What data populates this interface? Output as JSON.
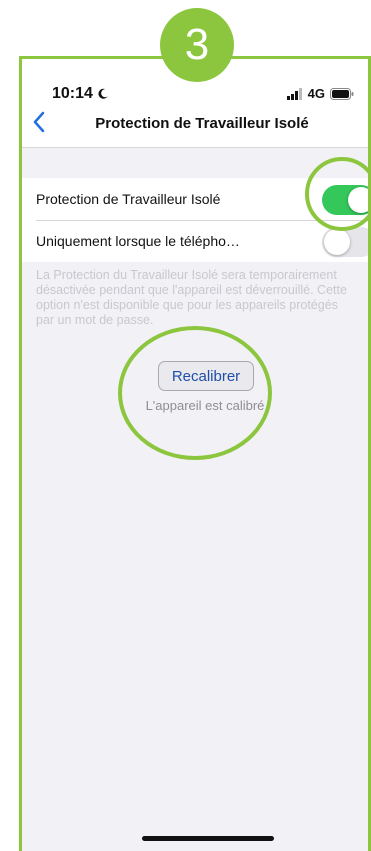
{
  "step": {
    "number": "3"
  },
  "status_bar": {
    "time": "10:14",
    "network": "4G"
  },
  "nav": {
    "title": "Protection de Travailleur Isolé"
  },
  "settings": {
    "rows": [
      {
        "label": "Protection de Travailleur Isolé",
        "toggle_on": true
      },
      {
        "label": "Uniquement lorsque le télépho…",
        "toggle_on": false
      }
    ],
    "footnote": "La Protection du Travailleur Isolé sera temporairement désactivée pendant que l'appareil est déverrouillé. Cette option n'est disponible que pour les appareils protégés par un mot de passe."
  },
  "calibration": {
    "button_label": "Recalibrer",
    "status": "L'appareil est calibré"
  },
  "colors": {
    "accent_green": "#8cc63f",
    "toggle_on": "#34c759",
    "link_blue": "#1f4fa8"
  },
  "icons": [
    "moon-icon",
    "signal-icon",
    "battery-icon",
    "back-chevron-icon"
  ]
}
